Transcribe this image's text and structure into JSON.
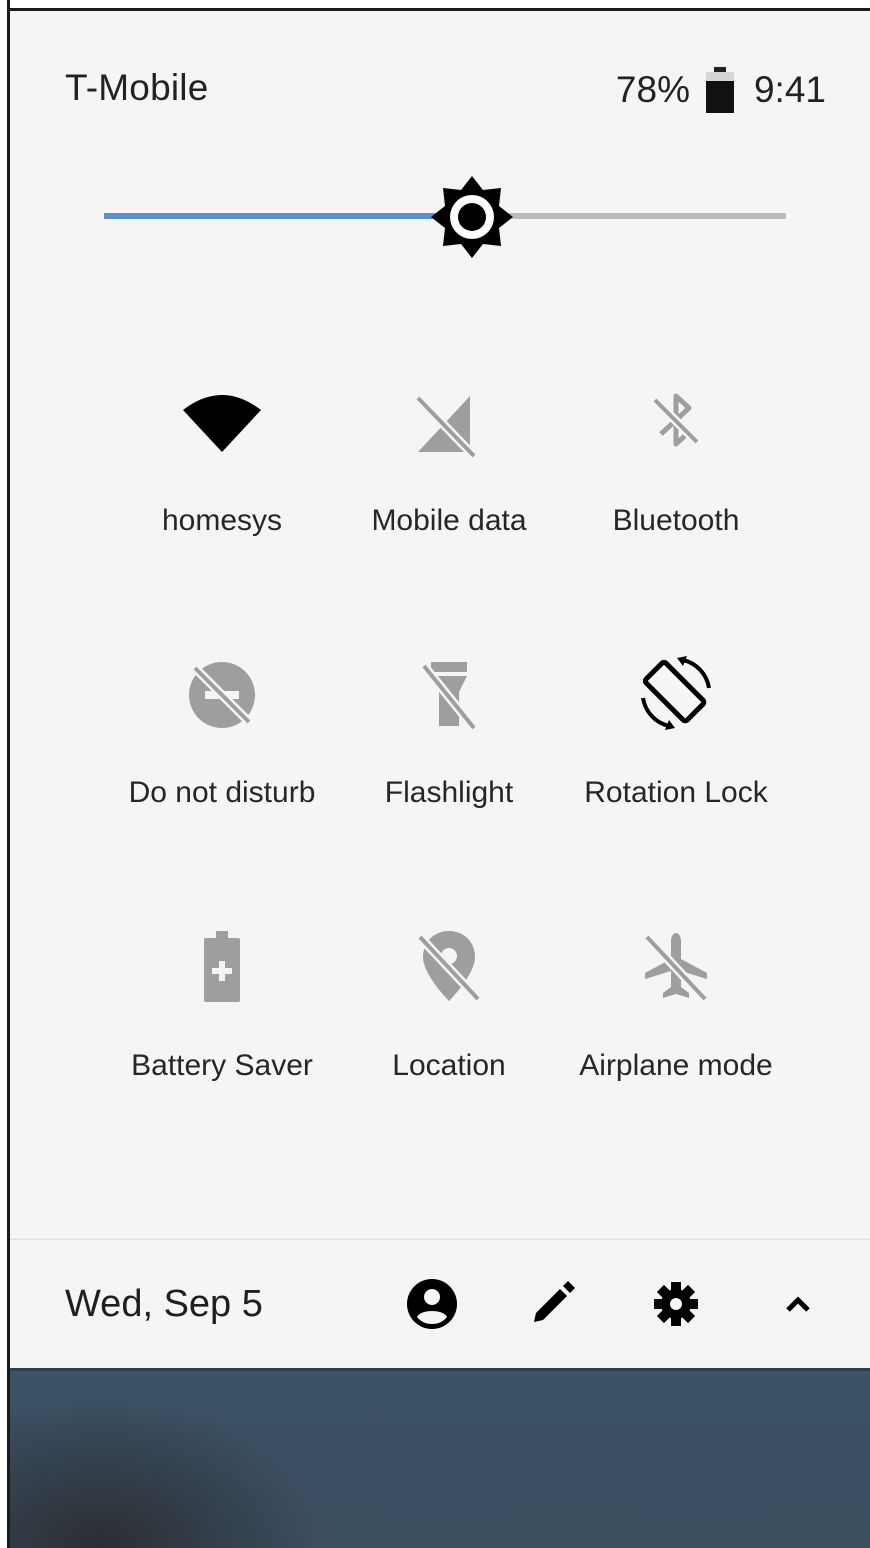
{
  "status_bar": {
    "carrier": "T-Mobile",
    "battery_percent": "78%",
    "time": "9:41",
    "battery_icon": "battery-icon"
  },
  "brightness": {
    "level": 0.54,
    "icon": "brightness-icon",
    "accent_color": "#5b8fd0",
    "track_color": "#bdbdbd"
  },
  "tiles": [
    {
      "label": "homesys",
      "icon": "wifi-icon",
      "active": true
    },
    {
      "label": "Mobile data",
      "icon": "mobile-data-off-icon",
      "active": false
    },
    {
      "label": "Bluetooth",
      "icon": "bluetooth-off-icon",
      "active": false
    },
    {
      "label": "Do not disturb",
      "icon": "do-not-disturb-off-icon",
      "active": false
    },
    {
      "label": "Flashlight",
      "icon": "flashlight-off-icon",
      "active": false
    },
    {
      "label": "Rotation Lock",
      "icon": "rotation-icon",
      "active": true
    },
    {
      "label": "Battery Saver",
      "icon": "battery-saver-icon",
      "active": false
    },
    {
      "label": "Location",
      "icon": "location-off-icon",
      "active": false
    },
    {
      "label": "Airplane mode",
      "icon": "airplane-off-icon",
      "active": false
    }
  ],
  "footer": {
    "date": "Wed, Sep 5",
    "icons": [
      "user-icon",
      "edit-icon",
      "settings-icon",
      "collapse-icon"
    ]
  },
  "colors": {
    "panel_background": "#f5f5f5",
    "active_icon": "#000000",
    "inactive_icon": "#9e9e9e"
  }
}
